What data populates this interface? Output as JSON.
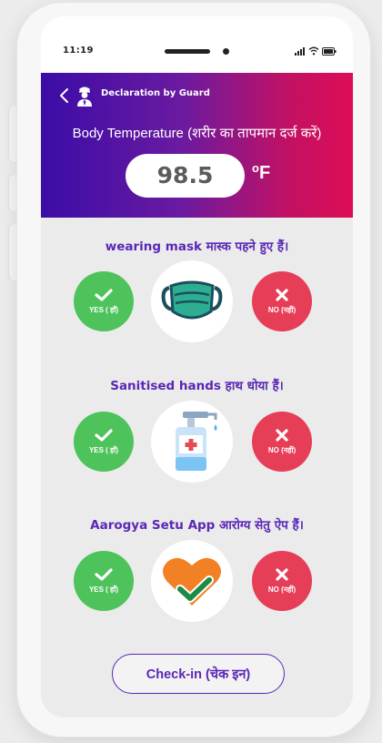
{
  "status_bar": {
    "time": "11:19",
    "icons": [
      "signal-icon",
      "wifi-icon",
      "battery-icon"
    ]
  },
  "header": {
    "back_icon": "chevron-left-icon",
    "guard_icon": "security-guard-icon",
    "title": "Declaration by Guard",
    "temperature_label": "Body Temperature  (शरीर का तापमान दर्ज करें)",
    "temperature_value": "98.5",
    "temperature_unit_degree": "o",
    "temperature_unit": "F"
  },
  "questions": [
    {
      "label": "wearing mask  मास्क पहने हुए हैं।",
      "icon": "face-mask-icon",
      "yes_label": "YES ( हाँ)",
      "no_label": "NO (नहीं)"
    },
    {
      "label": "Sanitised hands  हाथ धोया हैं।",
      "icon": "hand-sanitizer-icon",
      "yes_label": "YES ( हाँ)",
      "no_label": "NO (नहीं)"
    },
    {
      "label": "Aarogya Setu App  आरोग्य सेतु ऐप हैं।",
      "icon": "aarogya-setu-heart-icon",
      "yes_label": "YES ( हाँ)",
      "no_label": "NO (नहीं)"
    }
  ],
  "checkin_button": {
    "label": "Check-in (चेक इन)"
  },
  "colors": {
    "header_gradient": [
      "#3b0ca7",
      "#dd0d56"
    ],
    "yes": "#4fc35b",
    "no": "#e73e58",
    "accent": "#5a27b7"
  }
}
